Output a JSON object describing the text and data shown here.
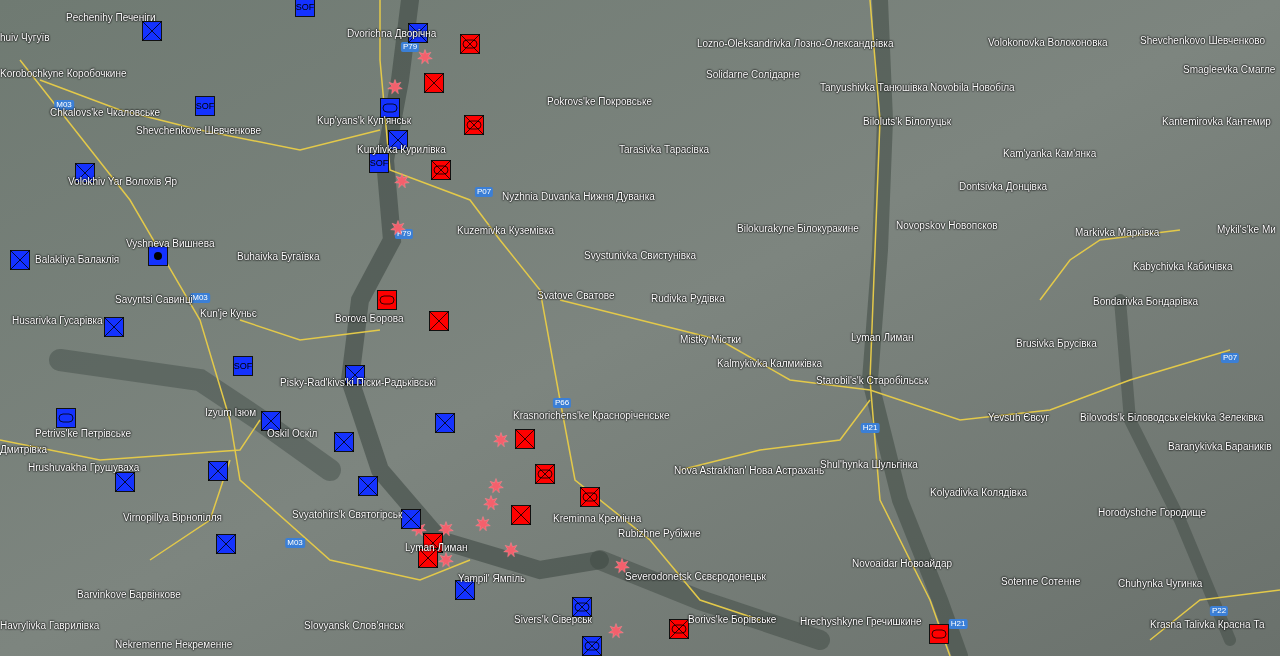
{
  "map": {
    "places": [
      {
        "name": "Pechenihy Печеніги"
      },
      {
        "name": "huiv Чугуїв"
      },
      {
        "name": "Dvorichna Дворічна"
      },
      {
        "name": "Lozno-Oleksandrivka Лозно-Олександрівка"
      },
      {
        "name": "Volokonovka Волоконовка"
      },
      {
        "name": "Shevchenkovo Шевченково"
      },
      {
        "name": "Korobochkyne Коробочкине"
      },
      {
        "name": "Solidarne Солідарне"
      },
      {
        "name": "Smagleevka Смагле"
      },
      {
        "name": "Tanyushivka Танюшівка"
      },
      {
        "name": "Novobila Новобіла"
      },
      {
        "name": "Pokrovs'ke Покровське"
      },
      {
        "name": "Chkalovs'ke Чкаловське"
      },
      {
        "name": "Kup'yans'k Куп'янськ"
      },
      {
        "name": "Biloluts'k Білолуцьк"
      },
      {
        "name": "Kantemirovka Кантемир"
      },
      {
        "name": "Shevchenkove Шевченкове"
      },
      {
        "name": "Kurylivka Курилівка"
      },
      {
        "name": "Tarasivka Тарасівка"
      },
      {
        "name": "Kam'yanka Кам'янка"
      },
      {
        "name": "Volokhiv Yar Волохів Яр"
      },
      {
        "name": "Dontsivka Донцівка"
      },
      {
        "name": "Nyzhnia Duvanka Нижня Дуванка"
      },
      {
        "name": "Kuzemivka Куземівка"
      },
      {
        "name": "Bilokurakyne Білокуракине"
      },
      {
        "name": "Novopskov Новопсков"
      },
      {
        "name": "Markivka Марківка"
      },
      {
        "name": "Mykil's'ke Ми"
      },
      {
        "name": "Vyshneva Вишнева"
      },
      {
        "name": "Balakliya Балаклія"
      },
      {
        "name": "Buhaivka Бугаївка"
      },
      {
        "name": "Svystunivka Свистунівка"
      },
      {
        "name": "Kabychivka Кабичівка"
      },
      {
        "name": "Savyntsi Савинці"
      },
      {
        "name": "Svatove Сватове"
      },
      {
        "name": "Rudivka Рудівка"
      },
      {
        "name": "Bondarivka Бондарівка"
      },
      {
        "name": "Husarivka Гусарівка"
      },
      {
        "name": "Kun'je Куньє"
      },
      {
        "name": "Borova Борова"
      },
      {
        "name": "Mistky Містки"
      },
      {
        "name": "Lyman Лиман"
      },
      {
        "name": "Brusivka Брусівка"
      },
      {
        "name": "Kalmykivka Калмиківка"
      },
      {
        "name": "Pisky-Rad'kivs'ki Піски-Радьківські"
      },
      {
        "name": "Starobil's'k Старобільськ"
      },
      {
        "name": "Izyum Ізюм"
      },
      {
        "name": "Krasnorichens'ke Краснорічeнське"
      },
      {
        "name": "Yevsuh Євсуг"
      },
      {
        "name": "Bilovods'k Біловодськ"
      },
      {
        "name": "elekivka Зелеківка"
      },
      {
        "name": "Petrivs'ke Петрівське"
      },
      {
        "name": "Oskil Оскіл"
      },
      {
        "name": "Дмитрівка"
      },
      {
        "name": "Baranykivka Бараників"
      },
      {
        "name": "Hrushuvakha Грушуваха"
      },
      {
        "name": "Nova Astrakhan' Нова Астрахань"
      },
      {
        "name": "Shul'hynka Шульгінка"
      },
      {
        "name": "Kolyadivka Колядівка"
      },
      {
        "name": "Virnopillya Вірнопілля"
      },
      {
        "name": "Svyatohirs'k Святогірськ"
      },
      {
        "name": "Kreminna Кремінна"
      },
      {
        "name": "Horodyshche Городище"
      },
      {
        "name": "Rubizhne Рубіжне"
      },
      {
        "name": "Lyman Лиман"
      },
      {
        "name": "Novoaidar Новоайдар"
      },
      {
        "name": "Yampil' Ямпіль"
      },
      {
        "name": "Severodonetsk Сєвєродонецьк"
      },
      {
        "name": "Sotenne Сотенне"
      },
      {
        "name": "Chuhynka Чугинка"
      },
      {
        "name": "Barvinkove Барвінкове"
      },
      {
        "name": "Havrylivka Гаврилівка"
      },
      {
        "name": "Slovyansk Слов'янськ"
      },
      {
        "name": "Sivers'k Сіверськ"
      },
      {
        "name": "Borivs'ke Борівське"
      },
      {
        "name": "Hrechyshkyne Гречишкине"
      },
      {
        "name": "Krasna Talivka Красна Та"
      },
      {
        "name": "Nekremenne Некременне"
      }
    ],
    "road_shields": [
      {
        "label": "M03"
      },
      {
        "label": "M03"
      },
      {
        "label": "M03"
      },
      {
        "label": "P79"
      },
      {
        "label": "P79"
      },
      {
        "label": "P07"
      },
      {
        "label": "P07"
      },
      {
        "label": "P66"
      },
      {
        "label": "H21"
      },
      {
        "label": "H21"
      },
      {
        "label": "P22"
      }
    ],
    "units": [
      {
        "kind": "infantry",
        "color": "#1432ff"
      },
      {
        "kind": "sof",
        "color": "#1432ff",
        "label": "SOF"
      },
      {
        "kind": "infantry",
        "color": "#1432ff"
      },
      {
        "kind": "sof",
        "color": "#1432ff",
        "label": "SOF"
      },
      {
        "kind": "armor",
        "color": "#1432ff"
      },
      {
        "kind": "infantry",
        "color": "#1432ff"
      },
      {
        "kind": "sof",
        "color": "#1432ff",
        "label": "SOF"
      },
      {
        "kind": "infantry",
        "color": "#1432ff"
      },
      {
        "kind": "infantry",
        "color": "#1432ff"
      },
      {
        "kind": "headquarters",
        "color": "#1432ff"
      },
      {
        "kind": "infantry",
        "color": "#1432ff"
      },
      {
        "kind": "sof",
        "color": "#1432ff",
        "label": "SOF"
      },
      {
        "kind": "infantry",
        "color": "#1432ff"
      },
      {
        "kind": "armor",
        "color": "#1432ff"
      },
      {
        "kind": "infantry",
        "color": "#1432ff"
      },
      {
        "kind": "infantry",
        "color": "#1432ff"
      },
      {
        "kind": "infantry",
        "color": "#1432ff"
      },
      {
        "kind": "infantry",
        "color": "#1432ff"
      },
      {
        "kind": "infantry",
        "color": "#1432ff"
      },
      {
        "kind": "infantry",
        "color": "#1432ff"
      },
      {
        "kind": "infantry",
        "color": "#1432ff"
      },
      {
        "kind": "infantry",
        "color": "#1432ff"
      },
      {
        "kind": "infantry",
        "color": "#1432ff"
      },
      {
        "kind": "mechanized",
        "color": "#1432ff"
      },
      {
        "kind": "mechanized",
        "color": "#1432ff"
      },
      {
        "kind": "mechanized",
        "color": "#ff0000"
      },
      {
        "kind": "infantry",
        "color": "#ff0000"
      },
      {
        "kind": "mechanized",
        "color": "#ff0000"
      },
      {
        "kind": "mechanized",
        "color": "#ff0000"
      },
      {
        "kind": "armor",
        "color": "#ff0000"
      },
      {
        "kind": "infantry",
        "color": "#ff0000"
      },
      {
        "kind": "infantry",
        "color": "#ff0000"
      },
      {
        "kind": "mechanized",
        "color": "#ff0000"
      },
      {
        "kind": "mechanized",
        "color": "#ff0000"
      },
      {
        "kind": "infantry",
        "color": "#ff0000"
      },
      {
        "kind": "infantry",
        "color": "#ff0000"
      },
      {
        "kind": "infantry",
        "color": "#ff0000"
      },
      {
        "kind": "mechanized",
        "color": "#ff0000"
      },
      {
        "kind": "armor",
        "color": "#ff0000"
      }
    ]
  }
}
